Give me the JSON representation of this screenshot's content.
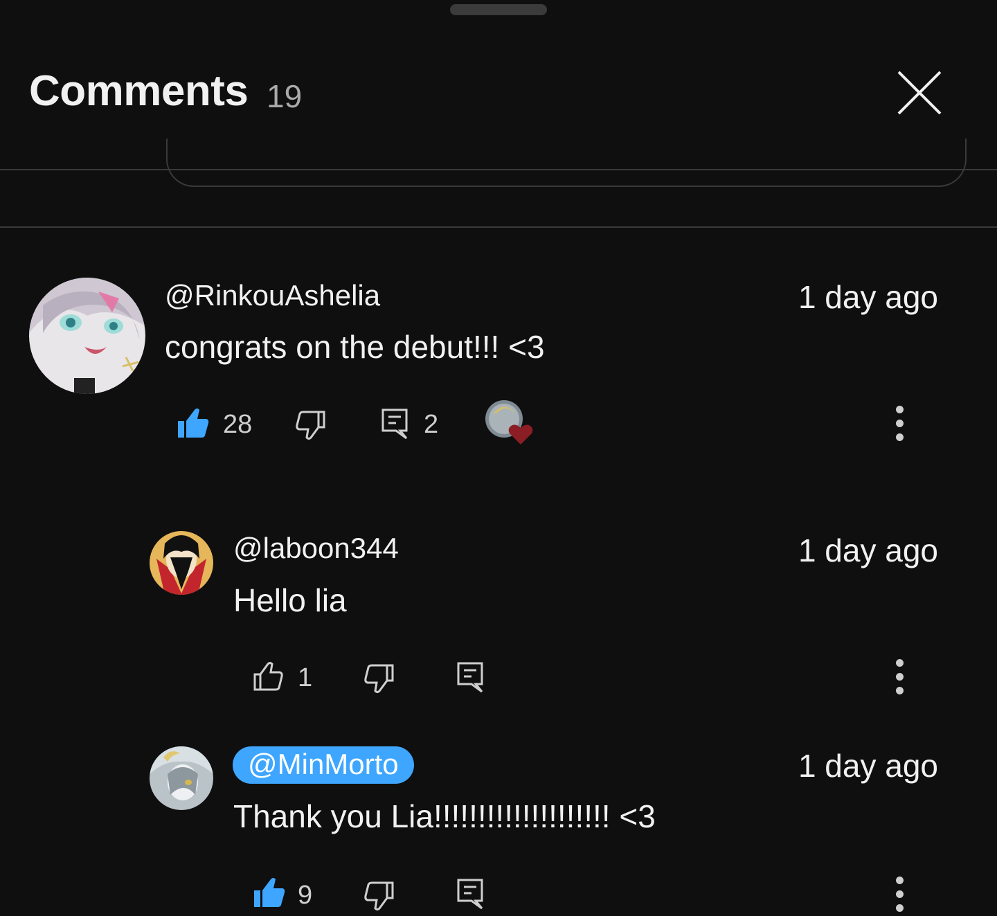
{
  "header": {
    "title": "Comments",
    "count": "19"
  },
  "comments": [
    {
      "handle": "@RinkouAshelia",
      "text": "congrats on the debut!!! <3",
      "time": "1 day ago",
      "likes": "28",
      "replies": "2",
      "liked": true
    },
    {
      "handle": "@laboon344",
      "text": "Hello lia",
      "time": "1 day ago",
      "likes": "1",
      "liked": false
    },
    {
      "handle": "@MinMorto",
      "text": "Thank you Lia!!!!!!!!!!!!!!!!!!!! <3",
      "time": "1 day ago",
      "likes": "9",
      "liked": true,
      "handle_highlighted": true
    }
  ],
  "icons": {
    "close": "close-icon",
    "like": "thumbs-up-icon",
    "dislike": "thumbs-down-icon",
    "reply": "reply-icon",
    "more": "more-vert-icon",
    "heart": "creator-heart-icon"
  },
  "colors": {
    "background": "#0f0f0f",
    "accent": "#3ea6ff",
    "heart": "#c4302b"
  }
}
